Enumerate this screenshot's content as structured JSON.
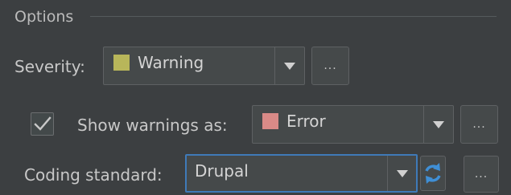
{
  "group": {
    "title": "Options"
  },
  "severity": {
    "label": "Severity:",
    "value": "Warning",
    "swatch_color": "#b8b65a"
  },
  "show_warnings": {
    "checked": true,
    "label": "Show warnings as:",
    "value": "Error",
    "swatch_color": "#d98a87"
  },
  "coding_standard": {
    "label": "Coding standard:",
    "value": "Drupal"
  },
  "buttons": {
    "more": "..."
  },
  "icons": {
    "dropdown": "chevron-down-icon",
    "refresh": "refresh-icon",
    "check": "checkmark-icon"
  },
  "colors": {
    "focus_border": "#3f7ab8",
    "refresh": "#3f8fd6"
  }
}
